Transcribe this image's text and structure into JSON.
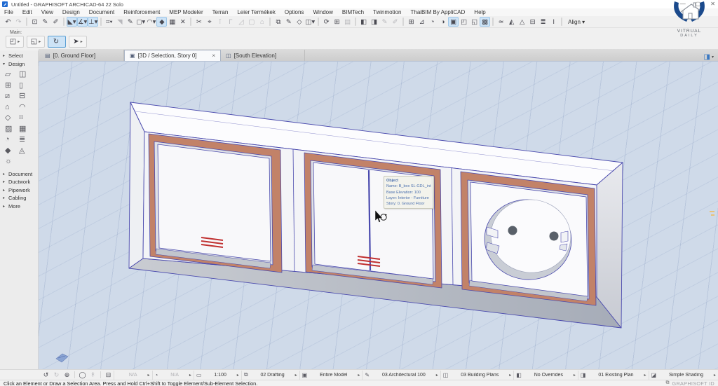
{
  "window": {
    "title": "Untitled - GRAPHISOFT ARCHICAD-64 22 Solo",
    "minimize": "—",
    "maximize": "▢",
    "close": "✕"
  },
  "menu": {
    "items": [
      {
        "label": "File"
      },
      {
        "label": "Edit"
      },
      {
        "label": "View"
      },
      {
        "label": "Design"
      },
      {
        "label": "Document"
      },
      {
        "label": "Reinforcement"
      },
      {
        "label": "MEP Modeler"
      },
      {
        "label": "Terran"
      },
      {
        "label": "Leier Termékek"
      },
      {
        "label": "Options"
      },
      {
        "label": "Window"
      },
      {
        "label": "BIMTech"
      },
      {
        "label": "Twinmotion"
      },
      {
        "label": "ThaiBIM By AppliCAD"
      },
      {
        "label": "Help"
      }
    ]
  },
  "toolbar": {
    "items": [
      {
        "g": "↶",
        "n": "undo-icon",
        "cls": "",
        "inter": "true"
      },
      {
        "g": "↷",
        "n": "redo-icon",
        "cls": "dis",
        "inter": "true"
      },
      {
        "g": "",
        "n": "separator",
        "cls": "sep",
        "inter": "false"
      },
      {
        "g": "⊡",
        "n": "favorites-icon",
        "cls": "",
        "inter": "true"
      },
      {
        "g": "✎",
        "n": "pick-up-parameters-icon",
        "cls": "",
        "inter": "true"
      },
      {
        "g": "✐",
        "n": "inject-parameters-icon",
        "cls": "",
        "inter": "true"
      },
      {
        "g": "",
        "n": "separator",
        "cls": "sep",
        "inter": "false"
      },
      {
        "g": "◣▾",
        "n": "arrow-tool-icon",
        "cls": "sel",
        "inter": "true"
      },
      {
        "g": "∡▾",
        "n": "marquee-tool-icon",
        "cls": "sel",
        "inter": "true"
      },
      {
        "g": "⊥▾",
        "n": "measure-tool-icon",
        "cls": "sel",
        "inter": "true"
      },
      {
        "g": "",
        "n": "separator",
        "cls": "sep",
        "inter": "false"
      },
      {
        "g": "⌗▾",
        "n": "grid-snap-icon",
        "cls": "",
        "inter": "true"
      },
      {
        "g": "◥",
        "n": "gravity-icon",
        "cls": "dis",
        "inter": "true"
      },
      {
        "g": "✎",
        "n": "guide-lines-icon",
        "cls": "",
        "inter": "true"
      },
      {
        "g": "◻▾",
        "n": "snap-guides-icon",
        "cls": "",
        "inter": "true"
      },
      {
        "g": "◠▾",
        "n": "snap-points-icon",
        "cls": "",
        "inter": "true"
      },
      {
        "g": "◆",
        "n": "element-snap-icon",
        "cls": "sel",
        "inter": "true"
      },
      {
        "g": "▦",
        "n": "grid-display-icon",
        "cls": "",
        "inter": "true"
      },
      {
        "g": "✕",
        "n": "split-icon",
        "cls": "",
        "inter": "true"
      },
      {
        "g": "",
        "n": "separator",
        "cls": "sep",
        "inter": "false"
      },
      {
        "g": "✂",
        "n": "trim-icon",
        "cls": "",
        "inter": "true"
      },
      {
        "g": "⌖",
        "n": "adjust-icon",
        "cls": "",
        "inter": "true"
      },
      {
        "g": "⊺",
        "n": "intersect-icon",
        "cls": "dis",
        "inter": "true"
      },
      {
        "g": "Γ",
        "n": "fillet-icon",
        "cls": "dis",
        "inter": "true"
      },
      {
        "g": "◿",
        "n": "chamfer-icon",
        "cls": "dis",
        "inter": "true"
      },
      {
        "g": "▢",
        "n": "resize-icon",
        "cls": "dis",
        "inter": "true"
      },
      {
        "g": "⌂",
        "n": "offset-icon",
        "cls": "dis",
        "inter": "true"
      },
      {
        "g": "",
        "n": "separator",
        "cls": "sep",
        "inter": "false"
      },
      {
        "g": "⧉",
        "n": "move-icon",
        "cls": "",
        "inter": "true"
      },
      {
        "g": "✎",
        "n": "rotate-icon",
        "cls": "",
        "inter": "true"
      },
      {
        "g": "◇",
        "n": "mirror-icon",
        "cls": "",
        "inter": "true"
      },
      {
        "g": "◫▾",
        "n": "multiply-icon",
        "cls": "",
        "inter": "true"
      },
      {
        "g": "",
        "n": "separator",
        "cls": "sep",
        "inter": "false"
      },
      {
        "g": "⟳",
        "n": "modify-icon",
        "cls": "",
        "inter": "true"
      },
      {
        "g": "⊞",
        "n": "magic-wand-icon",
        "cls": "",
        "inter": "true"
      },
      {
        "g": "▤",
        "n": "layers-settings-icon",
        "cls": "dis",
        "inter": "true"
      },
      {
        "g": "",
        "n": "separator",
        "cls": "sep",
        "inter": "false"
      },
      {
        "g": "◧",
        "n": "dimension-icon",
        "cls": "",
        "inter": "true"
      },
      {
        "g": "◨",
        "n": "label-icon",
        "cls": "",
        "inter": "true"
      },
      {
        "g": "✎",
        "n": "annotation-icon",
        "cls": "dis",
        "inter": "true"
      },
      {
        "g": "✐",
        "n": "text-icon",
        "cls": "dis",
        "inter": "true"
      },
      {
        "g": "",
        "n": "separator",
        "cls": "sep",
        "inter": "false"
      },
      {
        "g": "⊞",
        "n": "schedule-icon",
        "cls": "",
        "inter": "true"
      },
      {
        "g": "⊿",
        "n": "3d-document-icon",
        "cls": "",
        "inter": "true"
      },
      {
        "g": "◔",
        "n": "section-icon",
        "cls": "",
        "inter": "true"
      },
      {
        "g": "◑",
        "n": "elevation-icon",
        "cls": "",
        "inter": "true"
      },
      {
        "g": "▣",
        "n": "3d-window-icon",
        "cls": "sel",
        "inter": "true"
      },
      {
        "g": "◰",
        "n": "camera-icon",
        "cls": "",
        "inter": "true"
      },
      {
        "g": "◱",
        "n": "photo-render-icon",
        "cls": "",
        "inter": "true"
      },
      {
        "g": "▩",
        "n": "render-settings-icon",
        "cls": "sel",
        "inter": "true"
      },
      {
        "g": "",
        "n": "separator",
        "cls": "sep",
        "inter": "false"
      },
      {
        "g": "≃",
        "n": "layout-book-icon",
        "cls": "",
        "inter": "true"
      },
      {
        "g": "◭",
        "n": "publisher-icon",
        "cls": "",
        "inter": "true"
      },
      {
        "g": "△",
        "n": "teamwork-icon",
        "cls": "",
        "inter": "true"
      },
      {
        "g": "⊟",
        "n": "organizer-icon",
        "cls": "",
        "inter": "true"
      },
      {
        "g": "≣",
        "n": "navigator-icon",
        "cls": "",
        "inter": "true"
      },
      {
        "g": "I",
        "n": "text-style-icon",
        "cls": "",
        "inter": "true"
      },
      {
        "g": "",
        "n": "separator",
        "cls": "sep",
        "inter": "false"
      },
      {
        "g": "Align ▾",
        "n": "align-dropdown",
        "cls": "txt",
        "inter": "true"
      }
    ]
  },
  "toolbar2": {
    "main_label": "Main:",
    "buttons": [
      {
        "g": "◰",
        "caret": "▸",
        "n": "element-selection-button",
        "cls": "",
        "inter": "true"
      },
      {
        "g": "◱",
        "caret": "▸",
        "n": "marquee-selection-button",
        "cls": "",
        "inter": "true"
      },
      {
        "g": "↻",
        "caret": "",
        "n": "orbit-button",
        "cls": "sel",
        "inter": "true"
      },
      {
        "g": "➤",
        "caret": "▸",
        "n": "arrow-cursor-button",
        "cls": "",
        "inter": "true"
      }
    ]
  },
  "tabs": {
    "items": [
      {
        "label": "[0. Ground Floor]",
        "ig": "▤",
        "icon": "floor-plan-icon",
        "cls": "",
        "close": "",
        "closei": "false"
      },
      {
        "label": "[3D / Selection, Story 0]",
        "ig": "▣",
        "icon": "3d-view-icon",
        "cls": "active",
        "close": "×",
        "closei": "true"
      },
      {
        "label": "[South Elevation]",
        "ig": "◫",
        "icon": "elevation-view-icon",
        "cls": "",
        "close": "",
        "closei": "false"
      }
    ],
    "right_icon_caret": "▾"
  },
  "sidebar": {
    "top_sections": [
      {
        "arrow": "▸",
        "label": "Select"
      },
      {
        "arrow": "▾",
        "label": "Design"
      }
    ],
    "tools": [
      {
        "g": "▱",
        "n": "wall"
      },
      {
        "g": "◫",
        "n": "door"
      },
      {
        "g": "⊞",
        "n": "slab"
      },
      {
        "g": "▯",
        "n": "column"
      },
      {
        "g": "⧄",
        "n": "beam"
      },
      {
        "g": "⊟",
        "n": "window"
      },
      {
        "g": "⌂",
        "n": "roof"
      },
      {
        "g": "◠",
        "n": "shell"
      },
      {
        "g": "◇",
        "n": "morph"
      },
      {
        "g": "⌗",
        "n": "railing"
      },
      {
        "g": "▨",
        "n": "mesh"
      },
      {
        "g": "▦",
        "n": "curtain-wall"
      },
      {
        "g": "◔",
        "n": "zone"
      },
      {
        "g": "≣",
        "n": "stair"
      },
      {
        "g": "◆",
        "n": "object"
      },
      {
        "g": "◬",
        "n": "skylight"
      },
      {
        "g": "☼",
        "n": "lamp"
      }
    ],
    "bottom_sections": [
      {
        "arrow": "▸",
        "label": "Document"
      },
      {
        "arrow": "▸",
        "label": "Ductwork"
      },
      {
        "arrow": "▸",
        "label": "Pipework"
      },
      {
        "arrow": "▸",
        "label": "Cabling"
      },
      {
        "arrow": "▸",
        "label": "More"
      }
    ]
  },
  "viewport": {
    "tooltip": {
      "title": "Object",
      "l1": "Name: B_box SL-GDL_int",
      "l2": "Base Elevation: 100",
      "l3": "Layer: Interior - Furniture",
      "l4": "Story: 0. Ground Floor"
    }
  },
  "quickbar": {
    "icons": [
      {
        "g": "↺",
        "n": "navigate-back-icon",
        "cls": "",
        "inter": "true"
      },
      {
        "g": "↻",
        "n": "navigate-forward-icon",
        "cls": "dis",
        "inter": "true"
      },
      {
        "g": "⊕",
        "n": "zoom-in-icon",
        "cls": "",
        "inter": "true"
      },
      {
        "g": "",
        "n": "separator",
        "cls": "sep",
        "inter": "false"
      },
      {
        "g": "◯",
        "n": "comment-icon",
        "cls": "",
        "inter": "true"
      },
      {
        "g": "↟",
        "n": "previous-view-icon",
        "cls": "dis",
        "inter": "true"
      },
      {
        "g": "",
        "n": "separator",
        "cls": "sep",
        "inter": "false"
      },
      {
        "g": "⊟",
        "n": "zoom-box-icon",
        "cls": "",
        "inter": "true"
      }
    ],
    "fields": [
      {
        "ig": "",
        "icon": "blank",
        "label": "N/A",
        "cls": "dis",
        "n": "zoom-field"
      },
      {
        "ig": "◔",
        "icon": "orientation-icon",
        "label": "N/A",
        "cls": "dis",
        "n": "orientation-field"
      },
      {
        "ig": "▭",
        "icon": "scale-icon",
        "label": "1:100",
        "cls": "",
        "n": "scale-field"
      },
      {
        "ig": "⧉",
        "icon": "layer-icon",
        "label": "02 Drafting",
        "cls": "",
        "n": "layer-field"
      },
      {
        "ig": "▣",
        "icon": "structure-icon",
        "label": "Entire Model",
        "cls": "",
        "n": "structure-display-field"
      },
      {
        "ig": "✎",
        "icon": "pen-set-icon",
        "label": "03 Architectural 100",
        "cls": "",
        "n": "pen-set-field"
      },
      {
        "ig": "◫",
        "icon": "model-view-icon",
        "label": "03 Building Plans",
        "cls": "",
        "n": "model-view-options-field"
      },
      {
        "ig": "◧",
        "icon": "override-icon",
        "label": "No Overrides",
        "cls": "",
        "n": "graphic-override-field"
      },
      {
        "ig": "◨",
        "icon": "renovation-icon",
        "label": "01 Existing Plan",
        "cls": "",
        "n": "renovation-filter-field"
      },
      {
        "ig": "◪",
        "icon": "shading-icon",
        "label": "Simple Shading",
        "cls": "",
        "n": "view-style-field"
      }
    ]
  },
  "statusbar": {
    "message": "Click an Element or Draw a Selection Area. Press and Hold Ctrl+Shift to Toggle Element/Sub-Element Selection.",
    "right_label": "GRAPHISOFT ID"
  },
  "logo": {
    "line1": "VITRUAL",
    "line2": "DAILY"
  },
  "colors": {
    "canvas_bg": "#cfdae9",
    "edge_blue": "#4a4aae",
    "terracotta": "#c28268",
    "selection_highlight": "#cde3f6",
    "indicator_red": "#c03030"
  }
}
